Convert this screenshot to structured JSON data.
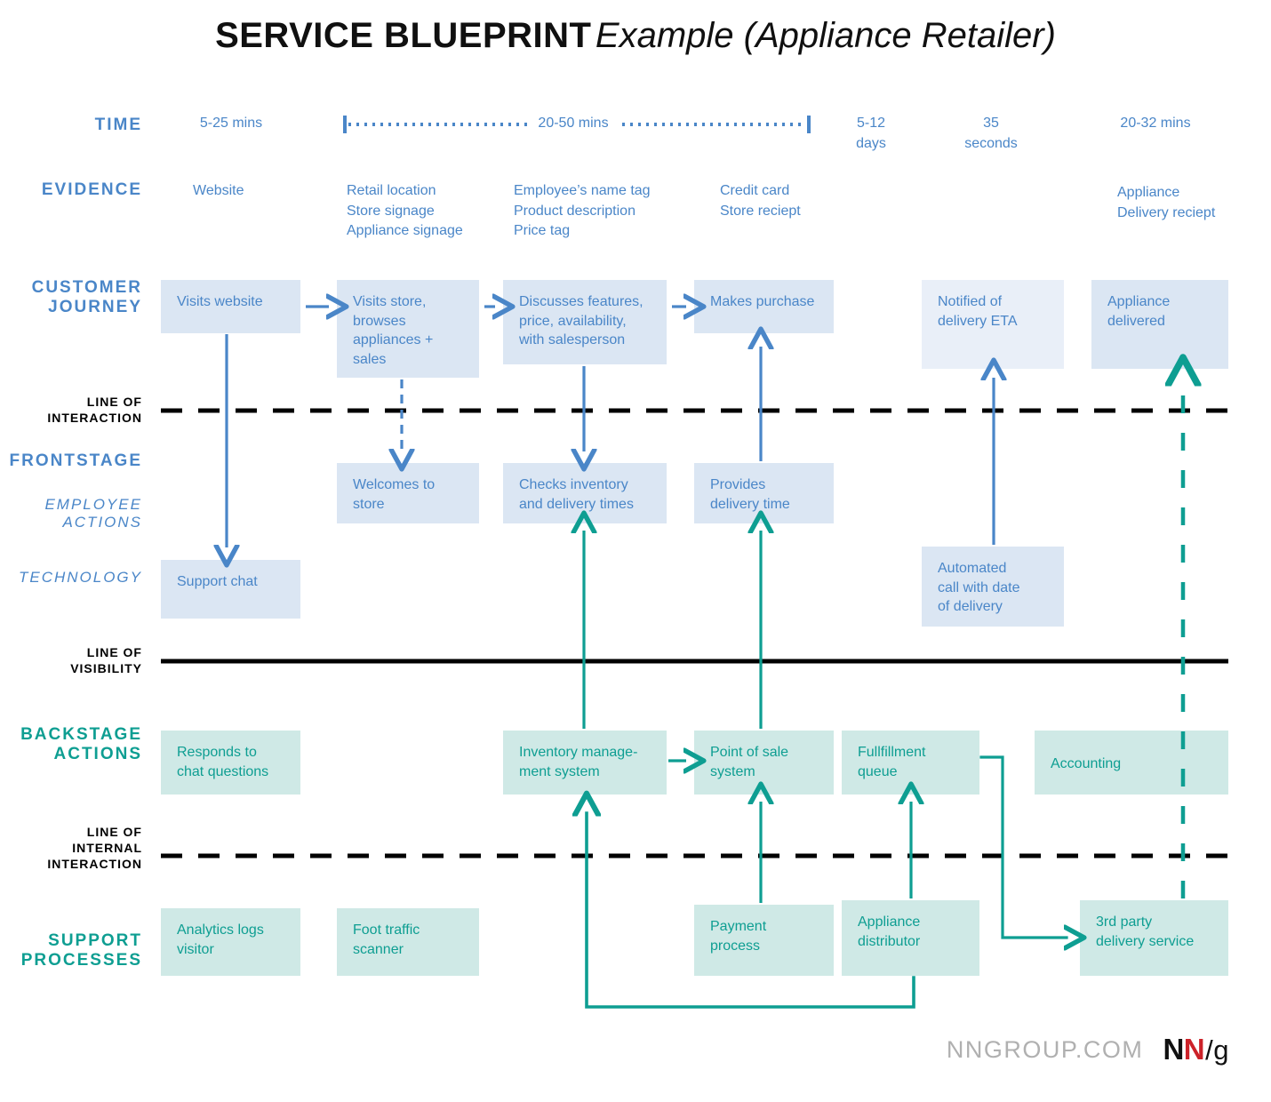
{
  "title": {
    "bold": "SERVICE BLUEPRINT",
    "italic": "Example (Appliance Retailer)"
  },
  "row_labels": {
    "time": "TIME",
    "evidence": "EVIDENCE",
    "customer_journey": "CUSTOMER\nJOURNEY",
    "line_of_interaction": "LINE OF\nINTERACTION",
    "frontstage": "FRONTSTAGE",
    "employee_actions": "EMPLOYEE\nACTIONS",
    "technology": "TECHNOLOGY",
    "line_of_visibility": "LINE OF\nVISIBILITY",
    "backstage_actions": "BACKSTAGE\nACTIONS",
    "line_of_internal_interaction": "LINE OF\nINTERNAL\nINTERACTION",
    "support_processes": "SUPPORT\nPROCESSES"
  },
  "time_row": [
    {
      "label": "5-25 mins"
    },
    {
      "label": "20-50 mins"
    },
    {
      "label": "5-12\ndays"
    },
    {
      "label": "35\nseconds"
    },
    {
      "label": "20-32 mins"
    }
  ],
  "evidence_row": [
    {
      "label": "Website"
    },
    {
      "label": "Retail location\nStore signage\nAppliance signage"
    },
    {
      "label": "Employee’s name tag\nProduct description\nPrice tag"
    },
    {
      "label": "Credit card\nStore reciept"
    },
    {
      "label": "Appliance\nDelivery reciept"
    }
  ],
  "customer_journey": [
    {
      "label": "Visits website"
    },
    {
      "label": "Visits store,\nbrowses\nappliances +\nsales"
    },
    {
      "label": "Discusses features,\nprice, availability,\nwith salesperson"
    },
    {
      "label": "Makes purchase"
    },
    {
      "label": "Notified of\ndelivery ETA"
    },
    {
      "label": "Appliance\ndelivered"
    }
  ],
  "employee_actions": [
    {
      "label": "Welcomes to\nstore"
    },
    {
      "label": "Checks inventory\nand delivery times"
    },
    {
      "label": "Provides\ndelivery time"
    }
  ],
  "technology": [
    {
      "label": "Support chat"
    },
    {
      "label": "Automated\ncall with date\nof delivery"
    }
  ],
  "backstage_actions": [
    {
      "label": "Responds to\nchat questions"
    },
    {
      "label": "Inventory manage-\nment system"
    },
    {
      "label": "Point of sale\nsystem"
    },
    {
      "label": "Fullfillment\nqueue"
    },
    {
      "label": "Accounting"
    }
  ],
  "support_processes": [
    {
      "label": "Analytics logs\nvisitor"
    },
    {
      "label": "Foot traffic\nscanner"
    },
    {
      "label": "Payment\nprocess"
    },
    {
      "label": "Appliance\ndistributor"
    },
    {
      "label": "3rd party\ndelivery service"
    }
  ],
  "footer": {
    "site": "NNGROUP.COM",
    "logo_n1": "N",
    "logo_n2": "N",
    "logo_slash": "/",
    "logo_g": "g"
  },
  "colors": {
    "blue_text": "#4a86c8",
    "blue_box": "#dbe6f3",
    "blue_box_pale": "#e9eff8",
    "teal_text": "#0e9e92",
    "teal_box": "#cfe9e6",
    "line_black": "#000000",
    "brand_red": "#cc2229"
  }
}
